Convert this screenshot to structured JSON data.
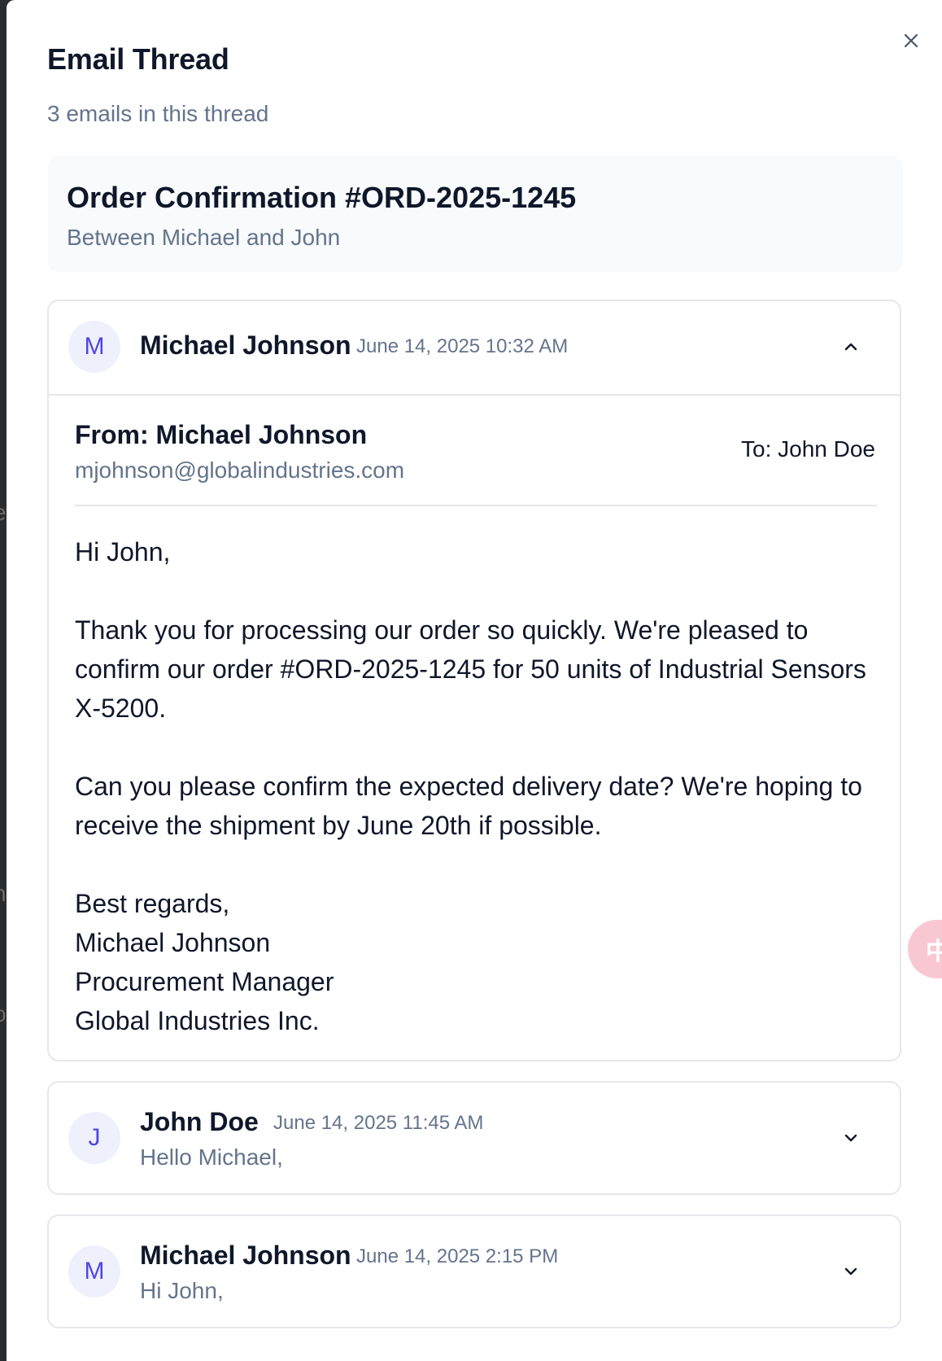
{
  "dialog": {
    "title": "Email Thread",
    "subtitle": "3 emails in this thread",
    "close_icon": "close-icon"
  },
  "thread": {
    "subject": "Order Confirmation #ORD-2025-1245",
    "participants": "Between Michael and John"
  },
  "emails": [
    {
      "avatar": "M",
      "sender": "Michael Johnson",
      "time": "June 14, 2025 10:32 AM",
      "expanded": true,
      "chevron_icon": "chevron-up-icon",
      "from": "From: Michael Johnson",
      "from_email": "mjohnson@globalindustries.com",
      "to": "To: John Doe",
      "body": [
        "Hi John,",
        "Thank you for processing our order so quickly. We're pleased to confirm our order #ORD-2025-1245 for 50 units of Industrial Sensors X-5200.",
        "Can you please confirm the expected delivery date? We're hoping to receive the shipment by June 20th if possible.",
        "Best regards,",
        "Michael Johnson",
        "Procurement Manager",
        "Global Industries Inc."
      ]
    },
    {
      "avatar": "J",
      "sender": "John Doe",
      "time": "June 14, 2025 11:45 AM",
      "expanded": false,
      "chevron_icon": "chevron-down-icon",
      "preview": "Hello Michael,"
    },
    {
      "avatar": "M",
      "sender": "Michael Johnson",
      "time": "June 14, 2025 2:15 PM",
      "expanded": false,
      "chevron_icon": "chevron-down-icon",
      "preview": "Hi John,"
    }
  ],
  "translate_widget": {
    "label": "中A",
    "icon": "translate-icon"
  },
  "colors": {
    "accent": "#4f46e5",
    "avatar_bg": "#eef0fb",
    "muted_text": "#64748b",
    "border": "#e5e7eb",
    "subject_bg": "#f8fafc",
    "translate_bg": "#f9c7d2"
  }
}
